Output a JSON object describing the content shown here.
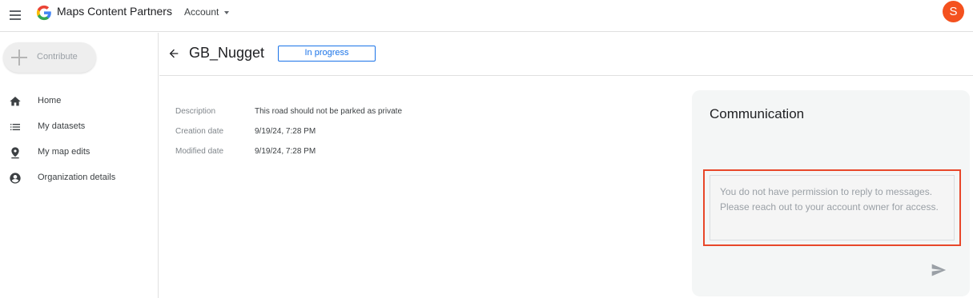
{
  "header": {
    "app_title": "Maps Content Partners",
    "account_label": "Account",
    "avatar_initial": "S",
    "avatar_color": "#f4511e"
  },
  "sidebar": {
    "contribute_label": "Contribute",
    "items": [
      {
        "label": "Home",
        "icon": "home-icon"
      },
      {
        "label": "My datasets",
        "icon": "list-icon"
      },
      {
        "label": "My map edits",
        "icon": "pin-icon"
      },
      {
        "label": "Organization details",
        "icon": "account-circle-icon"
      }
    ]
  },
  "main": {
    "title": "GB_Nugget",
    "status": "In progress",
    "status_color": "#1a73e8",
    "details": [
      {
        "label": "Description",
        "value": "This road should not be parked as private"
      },
      {
        "label": "Creation date",
        "value": "9/19/24, 7:28 PM"
      },
      {
        "label": "Modified date",
        "value": "9/19/24, 7:28 PM"
      }
    ]
  },
  "communication": {
    "title": "Communication",
    "placeholder": "You do not have permission to reply to messages. Please reach out to your account owner for access.",
    "highlight_color": "#e8472a"
  }
}
